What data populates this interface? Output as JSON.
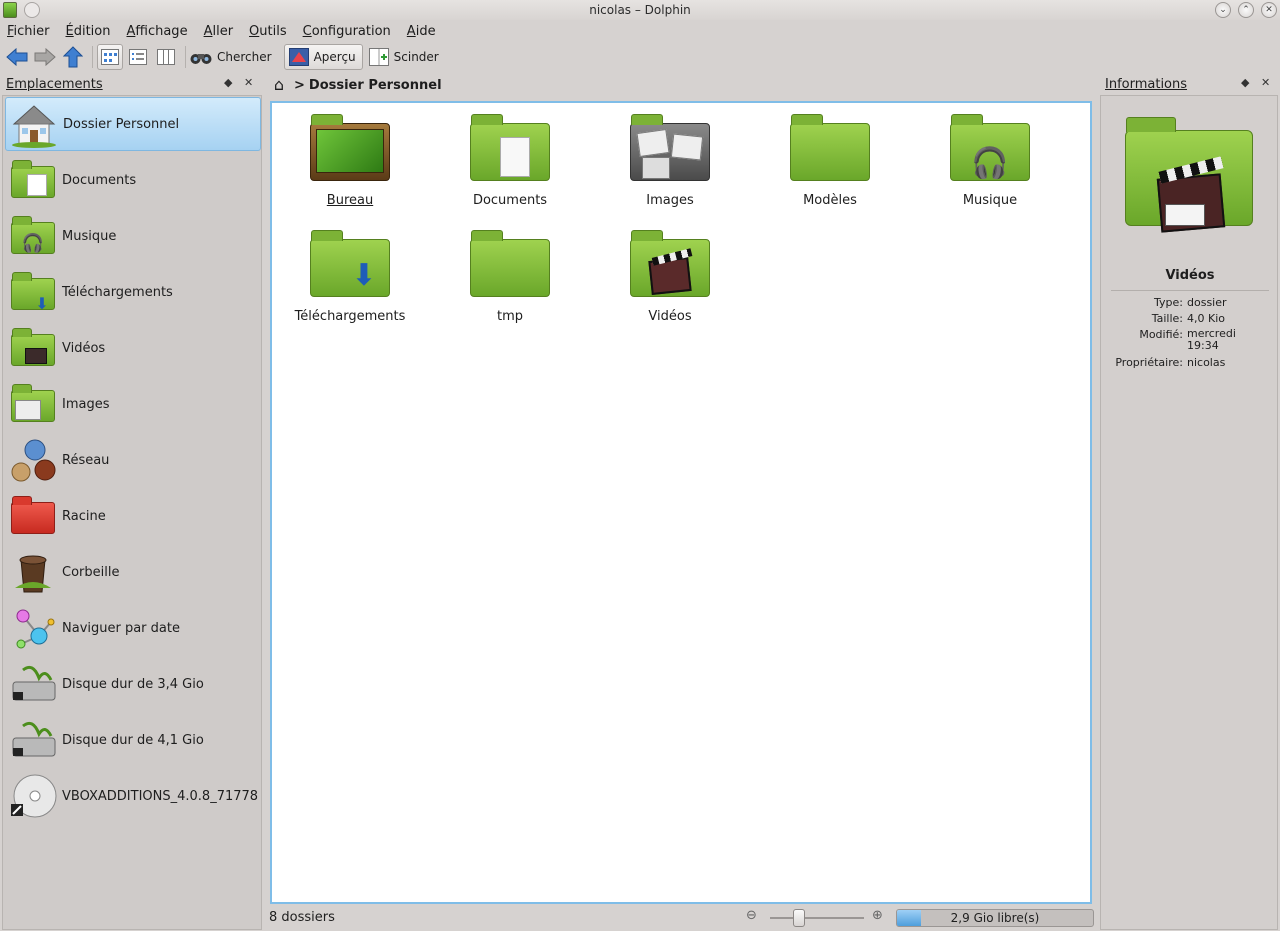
{
  "window": {
    "title": "nicolas – Dolphin",
    "controls": {
      "minimize": "⌄",
      "maximize": "⌃",
      "close": "✕"
    }
  },
  "menubar": {
    "items": [
      "Fichier",
      "Édition",
      "Affichage",
      "Aller",
      "Outils",
      "Configuration",
      "Aide"
    ]
  },
  "toolbar": {
    "search_label": "Chercher",
    "preview_label": "Aperçu",
    "split_label": "Scinder"
  },
  "places": {
    "title": "Emplacements",
    "items": [
      {
        "label": "Dossier Personnel",
        "icon": "home-icon",
        "selected": true
      },
      {
        "label": "Documents",
        "icon": "folder-documents-icon"
      },
      {
        "label": "Musique",
        "icon": "folder-music-icon"
      },
      {
        "label": "Téléchargements",
        "icon": "folder-downloads-icon"
      },
      {
        "label": "Vidéos",
        "icon": "folder-videos-icon"
      },
      {
        "label": "Images",
        "icon": "folder-images-icon"
      },
      {
        "label": "Réseau",
        "icon": "network-icon"
      },
      {
        "label": "Racine",
        "icon": "folder-root-icon"
      },
      {
        "label": "Corbeille",
        "icon": "trash-icon"
      },
      {
        "label": "Naviguer par date",
        "icon": "timeline-icon"
      },
      {
        "label": "Disque dur de 3,4 Gio",
        "icon": "harddisk-icon"
      },
      {
        "label": "Disque dur de 4,1 Gio",
        "icon": "harddisk-icon"
      },
      {
        "label": "VBOXADDITIONS_4.0.8_71778",
        "icon": "optical-disc-icon"
      }
    ]
  },
  "breadcrumb": {
    "separator": ">",
    "current": "Dossier Personnel"
  },
  "files": [
    {
      "name": "Bureau",
      "icon": "folder-desktop-icon",
      "current": true
    },
    {
      "name": "Documents",
      "icon": "folder-documents-icon"
    },
    {
      "name": "Images",
      "icon": "folder-images-icon"
    },
    {
      "name": "Modèles",
      "icon": "folder-templates-icon"
    },
    {
      "name": "Musique",
      "icon": "folder-music-icon"
    },
    {
      "name": "Téléchargements",
      "icon": "folder-downloads-icon"
    },
    {
      "name": "tmp",
      "icon": "folder-icon"
    },
    {
      "name": "Vidéos",
      "icon": "folder-videos-icon"
    }
  ],
  "info_panel": {
    "title": "Informations",
    "item_name": "Vidéos",
    "fields": [
      {
        "key": "Type:",
        "value": "dossier"
      },
      {
        "key": "Taille:",
        "value": "4,0 Kio"
      },
      {
        "key": "Modifié:",
        "value": "mercredi 19:34"
      },
      {
        "key": "Propriétaire:",
        "value": "nicolas"
      }
    ]
  },
  "statusbar": {
    "count": "8 dossiers",
    "free_space": "2,9 Gio libre(s)",
    "free_fraction": 0.12
  },
  "colors": {
    "accent": "#7fbde8",
    "selection": "#a6d2f2",
    "folder_green": "#8cc63f"
  }
}
